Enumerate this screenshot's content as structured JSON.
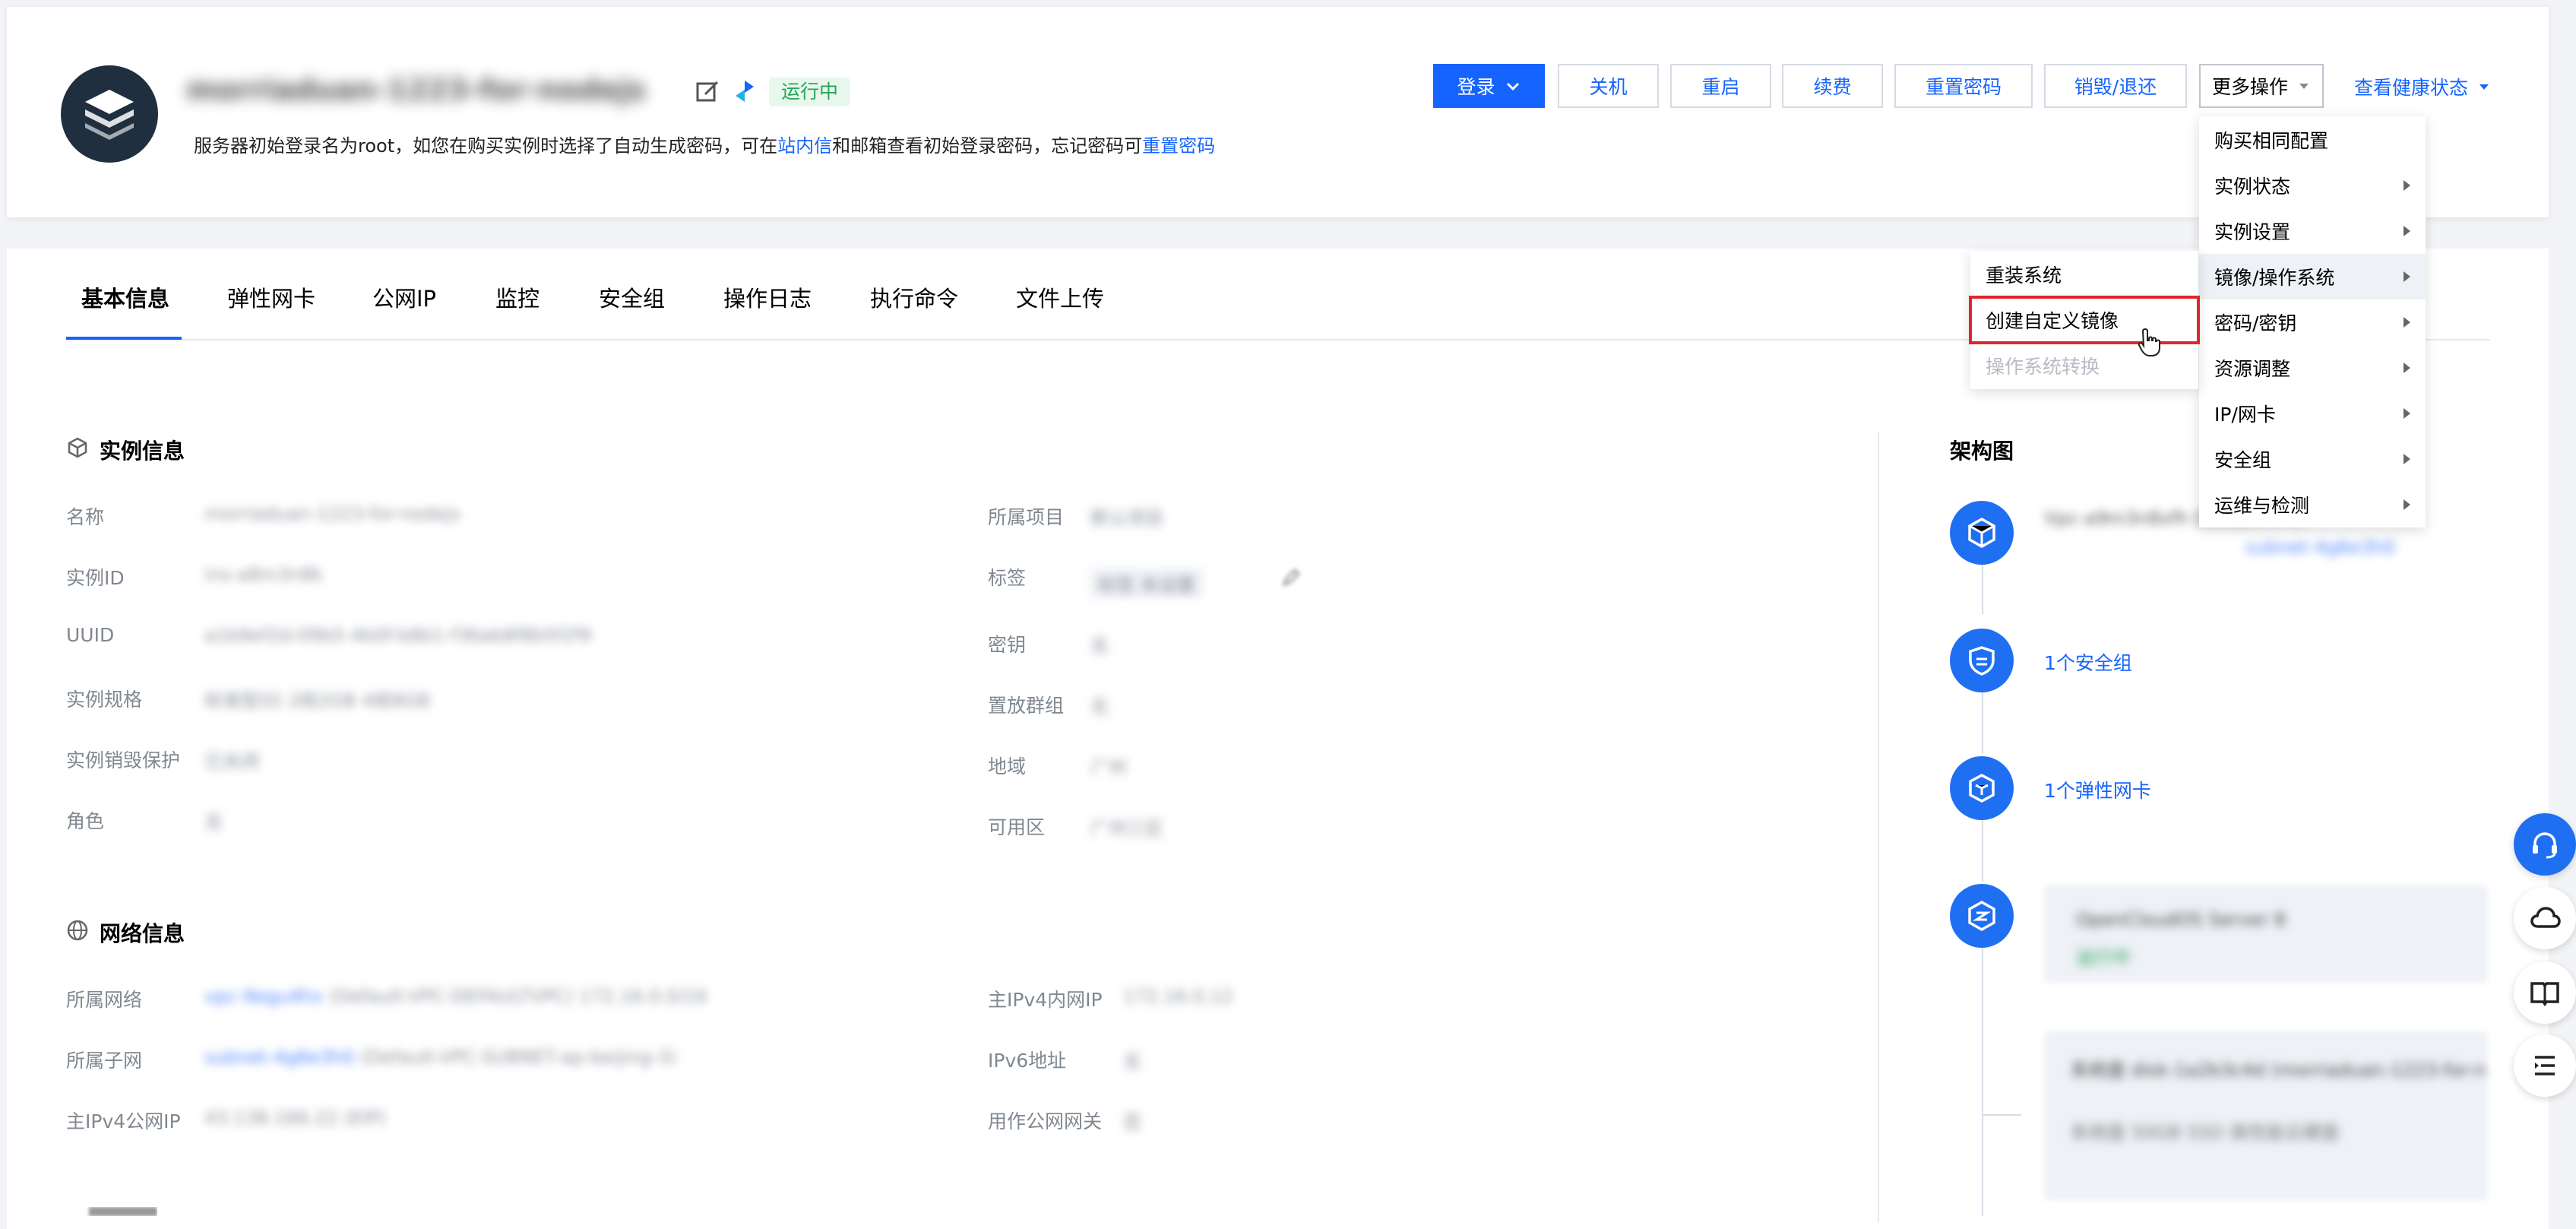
{
  "header": {
    "instance_name": "morriaduan-1223-for-nodejs",
    "status": "运行中",
    "hint_prefix": "服务器初始登录名为root，如您在购买实例时选择了自动生成密码，可在",
    "hint_link_inbox": "站内信",
    "hint_middle": "和邮箱查看初始登录密码，忘记密码可",
    "hint_link_reset": "重置密码"
  },
  "toolbar": {
    "login": "登录",
    "shutdown": "关机",
    "restart": "重启",
    "renew": "续费",
    "reset_password": "重置密码",
    "destroy": "销毁/退还",
    "more": "更多操作",
    "health": "查看健康状态"
  },
  "more_menu": {
    "items": [
      {
        "label": "购买相同配置"
      },
      {
        "label": "实例状态"
      },
      {
        "label": "实例设置"
      },
      {
        "label": "镜像/操作系统"
      },
      {
        "label": "密码/密钥"
      },
      {
        "label": "资源调整"
      },
      {
        "label": "IP/网卡"
      },
      {
        "label": "安全组"
      },
      {
        "label": "运维与检测"
      }
    ]
  },
  "sub_menu": {
    "items": [
      {
        "label": "重装系统"
      },
      {
        "label": "创建自定义镜像"
      },
      {
        "label": "操作系统转换"
      }
    ]
  },
  "tabs": [
    {
      "label": "基本信息"
    },
    {
      "label": "弹性网卡"
    },
    {
      "label": "公网IP"
    },
    {
      "label": "监控"
    },
    {
      "label": "安全组"
    },
    {
      "label": "操作日志"
    },
    {
      "label": "执行命令"
    },
    {
      "label": "文件上传"
    }
  ],
  "instance_info": {
    "title": "实例信息",
    "left": [
      {
        "label": "名称",
        "value": "morriaduan-1223-for-nodejs"
      },
      {
        "label": "实例ID",
        "value": "ins-a8m3n8k"
      },
      {
        "label": "UUID",
        "value": "a1b9ef2d-09b5-4b0f-b8b1-f36ab8f8b5f2f9"
      },
      {
        "label": "实例规格",
        "value": "标准型S5 2核2GB 4核8GB"
      },
      {
        "label": "实例销毁保护",
        "value": "已关闭"
      },
      {
        "label": "角色",
        "value": "无"
      }
    ],
    "right": [
      {
        "label": "所属项目",
        "value": "默认项目"
      },
      {
        "label": "标签",
        "value": "标签 未设置"
      },
      {
        "label": "密钥",
        "value": "无"
      },
      {
        "label": "置放群组",
        "value": "无"
      },
      {
        "label": "地域",
        "value": "广州"
      },
      {
        "label": "可用区",
        "value": "广州三区"
      }
    ]
  },
  "network_info": {
    "title": "网络信息",
    "left": [
      {
        "label": "所属网络",
        "link": "vpc-9egu4hx",
        "value": "(Default-VPC-DEFAULTVPC) 172.16.0.0/16"
      },
      {
        "label": "所属子网",
        "link": "subnet-4g6e3h0",
        "value": "(Default-VPC-SUBNET-ap-beijing-3)"
      },
      {
        "label": "主IPv4公网IP",
        "link": "",
        "value": "43.138.166.22 (EIP)"
      }
    ],
    "right": [
      {
        "label": "主IPv4内网IP",
        "value": "172.16.0.12"
      },
      {
        "label": "IPv6地址",
        "value": "无"
      },
      {
        "label": "用作公网网关",
        "value": "否"
      }
    ]
  },
  "arch": {
    "title": "架构图",
    "vpc_text": "Vpc-a9m3n8xfh Default-VPC",
    "vpc_link": "subnet-4g6e3h0",
    "security_group": "1个安全组",
    "eni": "1个弹性网卡",
    "cvm_line1": "OpenCloudOS Server 8",
    "cvm_line2": "运行中",
    "disk_line1": "系统盘 disk-1a2b3c4d (morriaduan-1223-for-n",
    "disk_line2": "系统盘 50GB SSD 高性能云硬盘"
  }
}
